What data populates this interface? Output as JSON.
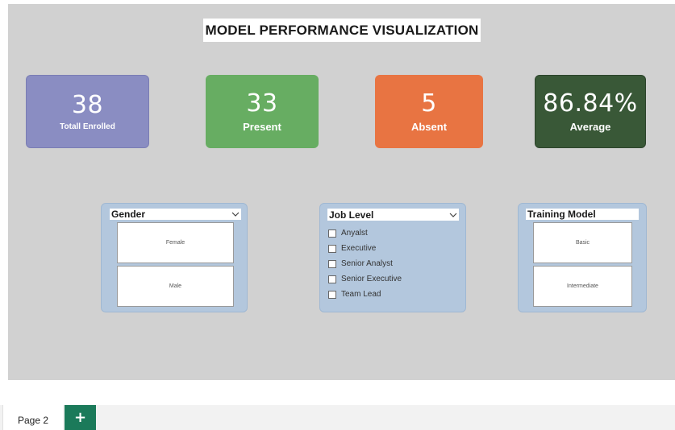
{
  "report": {
    "title": "MODEL PERFORMANCE VISUALIZATION"
  },
  "cards": {
    "enrolled": {
      "value": "38",
      "label": "Totall Enrolled",
      "color": "#8a8dc2"
    },
    "present": {
      "value": "33",
      "label": "Present",
      "color": "#67ad62"
    },
    "absent": {
      "value": "5",
      "label": "Absent",
      "color": "#e87442"
    },
    "average": {
      "value": "86.84%",
      "label": "Average",
      "color": "#395837"
    }
  },
  "slicers": {
    "gender": {
      "title": "Gender",
      "options": [
        "Female",
        "Male"
      ]
    },
    "job_level": {
      "title": "Job Level",
      "options": [
        "Anyalst",
        "Executive",
        "Senior Analyst",
        "Senior Executive",
        "Team Lead"
      ]
    },
    "training_model": {
      "title": "Training Model",
      "options": [
        "Basic",
        "Intermediate"
      ]
    }
  },
  "tabs": {
    "pages": [
      "Page 2"
    ],
    "add_label": "+",
    "add_color": "#1b7a5a"
  },
  "icons": {
    "dropdown": "chevron-down-icon",
    "checkbox": "checkbox-icon"
  }
}
